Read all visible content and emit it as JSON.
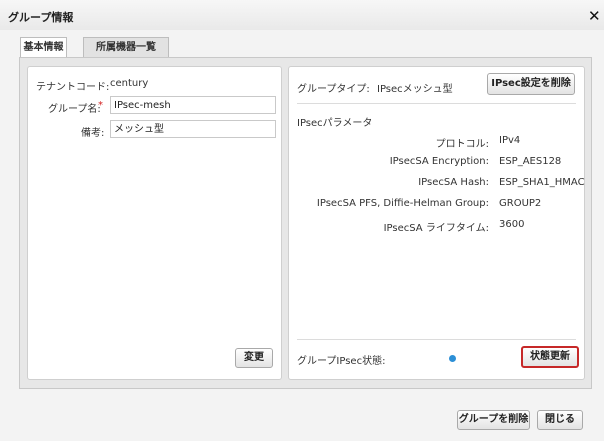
{
  "dialog": {
    "title": "グループ情報",
    "close_icon": "close-icon"
  },
  "tabs": [
    {
      "label": "基本情報",
      "active": true
    },
    {
      "label": "所属機器一覧",
      "active": false
    }
  ],
  "left": {
    "tenant_code_label": "テナントコード:",
    "tenant_code_value": "century",
    "group_name_label": "グループ名:",
    "required_mark": "*",
    "group_name_value": "IPsec-mesh",
    "note_label": "備考:",
    "note_value": "メッシュ型",
    "change_button": "変更"
  },
  "right": {
    "group_type_label": "グループタイプ:",
    "group_type_value": "IPsecメッシュ型",
    "delete_ipsec_button": "IPsec設定を削除",
    "params_title": "IPsecパラメータ",
    "params": [
      {
        "label": "プロトコル:",
        "value": "IPv4"
      },
      {
        "label": "IPsecSA Encryption:",
        "value": "ESP_AES128"
      },
      {
        "label": "IPsecSA Hash:",
        "value": "ESP_SHA1_HMAC"
      },
      {
        "label": "IPsecSA PFS, Diffie-Helman Group:",
        "value": "GROUP2"
      },
      {
        "label": "IPsecSA ライフタイム:",
        "value": "3600"
      }
    ],
    "status_label": "グループIPsec状態:",
    "status_color": "#2c8fd6",
    "refresh_button": "状態更新"
  },
  "footer": {
    "delete_group_button": "グループを削除",
    "close_button": "閉じる"
  }
}
